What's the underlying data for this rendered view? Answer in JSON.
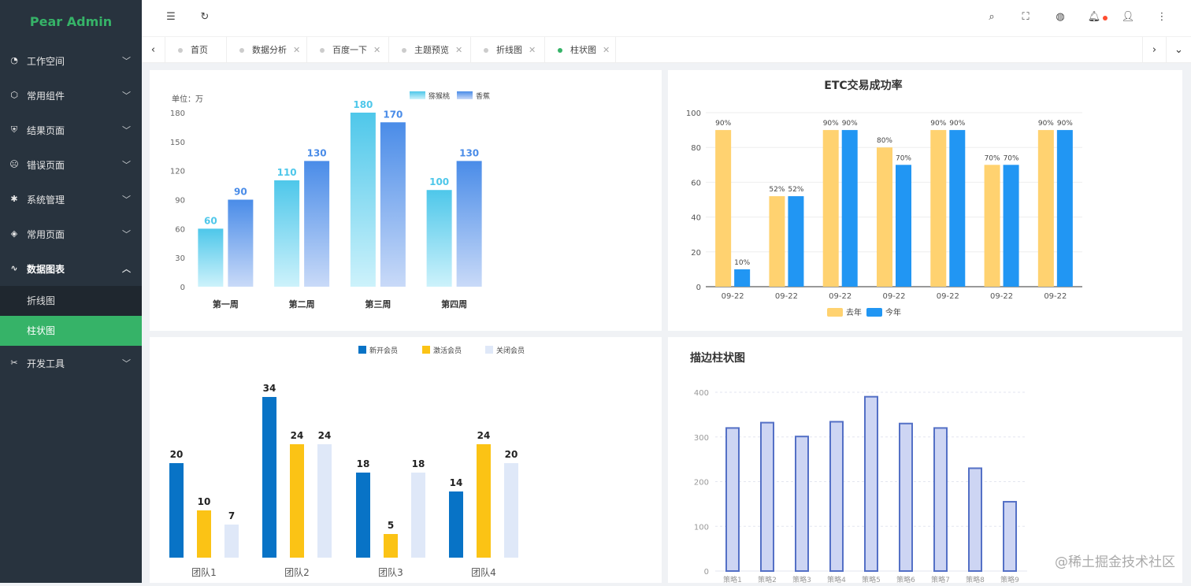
{
  "app": {
    "brand": "Pear Admin"
  },
  "sidebar": {
    "items": [
      {
        "label": "工作空间",
        "icon": "dashboard-icon"
      },
      {
        "label": "常用组件",
        "icon": "cube-icon"
      },
      {
        "label": "结果页面",
        "icon": "shield-check-icon"
      },
      {
        "label": "错误页面",
        "icon": "frown-icon"
      },
      {
        "label": "系统管理",
        "icon": "gear-icon"
      },
      {
        "label": "常用页面",
        "icon": "layers-icon"
      },
      {
        "label": "数据图表",
        "icon": "pulse-icon"
      },
      {
        "label": "开发工具",
        "icon": "tools-icon"
      }
    ],
    "submenu": [
      {
        "label": "折线图"
      },
      {
        "label": "柱状图"
      }
    ]
  },
  "tabs": [
    {
      "label": "首页"
    },
    {
      "label": "数据分析"
    },
    {
      "label": "百度一下"
    },
    {
      "label": "主题预览"
    },
    {
      "label": "折线图"
    },
    {
      "label": "柱状图"
    }
  ],
  "colors": {
    "accent": "#36b368",
    "sidebar": "#28333e",
    "notify": "#ff4d30"
  },
  "watermark": "@稀土掘金技术社区",
  "chart_data": [
    {
      "type": "bar",
      "unit_label": "单位：万",
      "categories": [
        "第一周",
        "第二周",
        "第三周",
        "第四周"
      ],
      "series": [
        {
          "name": "猕猴桃",
          "values": [
            60,
            110,
            180,
            100
          ],
          "color": "#4ec7ea"
        },
        {
          "name": "香蕉",
          "values": [
            90,
            130,
            170,
            130
          ],
          "color": "#4a8ce8"
        }
      ],
      "ylim": [
        0,
        180
      ],
      "yticks": [
        0,
        30,
        60,
        90,
        120,
        150,
        180
      ],
      "legend": "top-right"
    },
    {
      "type": "bar",
      "title": "ETC交易成功率",
      "categories": [
        "09-22",
        "09-22",
        "09-22",
        "09-22",
        "09-22",
        "09-22",
        "09-22"
      ],
      "series": [
        {
          "name": "去年",
          "values": [
            90,
            52,
            90,
            80,
            90,
            70,
            90
          ],
          "color": "#ffd270"
        },
        {
          "name": "今年",
          "values": [
            10,
            52,
            90,
            70,
            90,
            70,
            90
          ],
          "color": "#2196f3"
        }
      ],
      "ylim": [
        0,
        100
      ],
      "yticks": [
        0,
        20,
        40,
        60,
        80,
        100
      ],
      "legend": "bottom"
    },
    {
      "type": "bar",
      "categories": [
        "团队1",
        "团队2",
        "团队3",
        "团队4"
      ],
      "series": [
        {
          "name": "新开会员",
          "values": [
            20,
            34,
            18,
            14
          ],
          "color": "#0873c6"
        },
        {
          "name": "激活会员",
          "values": [
            10,
            24,
            5,
            24
          ],
          "color": "#fbc315"
        },
        {
          "name": "关闭会员",
          "values": [
            7,
            24,
            18,
            20
          ],
          "color": "#dfe8f8"
        }
      ],
      "ylim": [
        0,
        36
      ],
      "legend": "top"
    },
    {
      "type": "bar",
      "title": "描边柱状图",
      "categories": [
        "策略1",
        "策略2",
        "策略3",
        "策略4",
        "策略5",
        "策略6",
        "策略7",
        "策略8",
        "策略9"
      ],
      "series": [
        {
          "name": "",
          "values": [
            320,
            332,
            301,
            334,
            390,
            330,
            320,
            230,
            155
          ],
          "color": "#cdd5f3"
        }
      ],
      "ylim": [
        0,
        400
      ],
      "yticks": [
        0,
        100,
        200,
        300,
        400
      ],
      "grid": true
    }
  ]
}
